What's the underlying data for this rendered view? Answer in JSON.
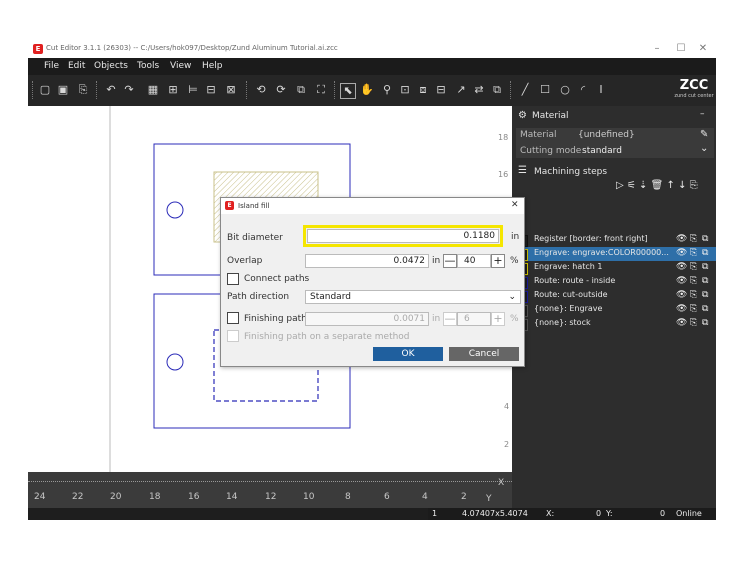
{
  "window": {
    "title": "Cut Editor 3.1.1 (26303) -- C:/Users/hok097/Desktop/Zund Aluminum Tutorial.ai.zcc",
    "logo_letter": "E",
    "minimize": "–",
    "maximize": "☐",
    "close": "✕"
  },
  "menu": [
    "File",
    "Edit",
    "Objects",
    "Tools",
    "View",
    "Help"
  ],
  "brand": {
    "name": "ZCC",
    "tagline": "zund cut center"
  },
  "ruler": {
    "vertical": [
      "18",
      "16",
      "4",
      "2"
    ],
    "horizontal": [
      "24",
      "22",
      "20",
      "18",
      "16",
      "14",
      "12",
      "10",
      "8",
      "6",
      "4",
      "2"
    ],
    "x_label": "X",
    "y_label": "Y"
  },
  "status": {
    "count": "1",
    "coords": "4.07407x5.4074",
    "x_label": "X:",
    "x_value": "0",
    "y_label": "Y:",
    "y_value": "0",
    "state": "Online"
  },
  "material_panel": {
    "header": "Material",
    "collapse": "–",
    "material_label": "Material",
    "material_value": "{undefined}",
    "cutting_mode_label": "Cutting mode",
    "cutting_mode_value": "standard"
  },
  "machining_panel": {
    "header": "Machining steps",
    "steps": [
      {
        "label": "Register [border: front right]",
        "color": "#111111"
      },
      {
        "label": "Engrave: engrave:COLOR00000...",
        "color": "#d6c600",
        "selected": true
      },
      {
        "label": "Engrave: hatch 1",
        "color": "#d6c600"
      },
      {
        "label": "Route: route - inside",
        "color": "#1a1aa0"
      },
      {
        "label": "Route: cut-outside",
        "color": "#1a1aa0"
      },
      {
        "label": "{none}: Engrave",
        "color": "#555555"
      },
      {
        "label": "{none}: stock",
        "color": "#555555"
      }
    ]
  },
  "dialog": {
    "title": "Island fill",
    "close": "✕",
    "bit_diameter_label": "Bit diameter",
    "bit_diameter_value": "0.1180",
    "bit_diameter_unit": "in",
    "overlap_label": "Overlap",
    "overlap_value": "0.0472",
    "overlap_unit": "in",
    "overlap_percent": "40",
    "percent_sign": "%",
    "minus": "—",
    "plus": "+",
    "connect_paths_label": "Connect paths",
    "path_direction_label": "Path direction",
    "path_direction_value": "Standard",
    "finishing_path_label": "Finishing path",
    "finishing_path_value": "0.0071",
    "finishing_unit": "in",
    "finishing_percent": "6",
    "finishing_separate_label": "Finishing path on a separate method",
    "ok": "OK",
    "cancel": "Cancel"
  },
  "colors": {
    "highlight": "#f5e600",
    "ok_button": "#1f5f9e",
    "cancel_button": "#666666",
    "selected_row": "#2e6fa8",
    "shape_stroke": "#2b2bb8"
  }
}
